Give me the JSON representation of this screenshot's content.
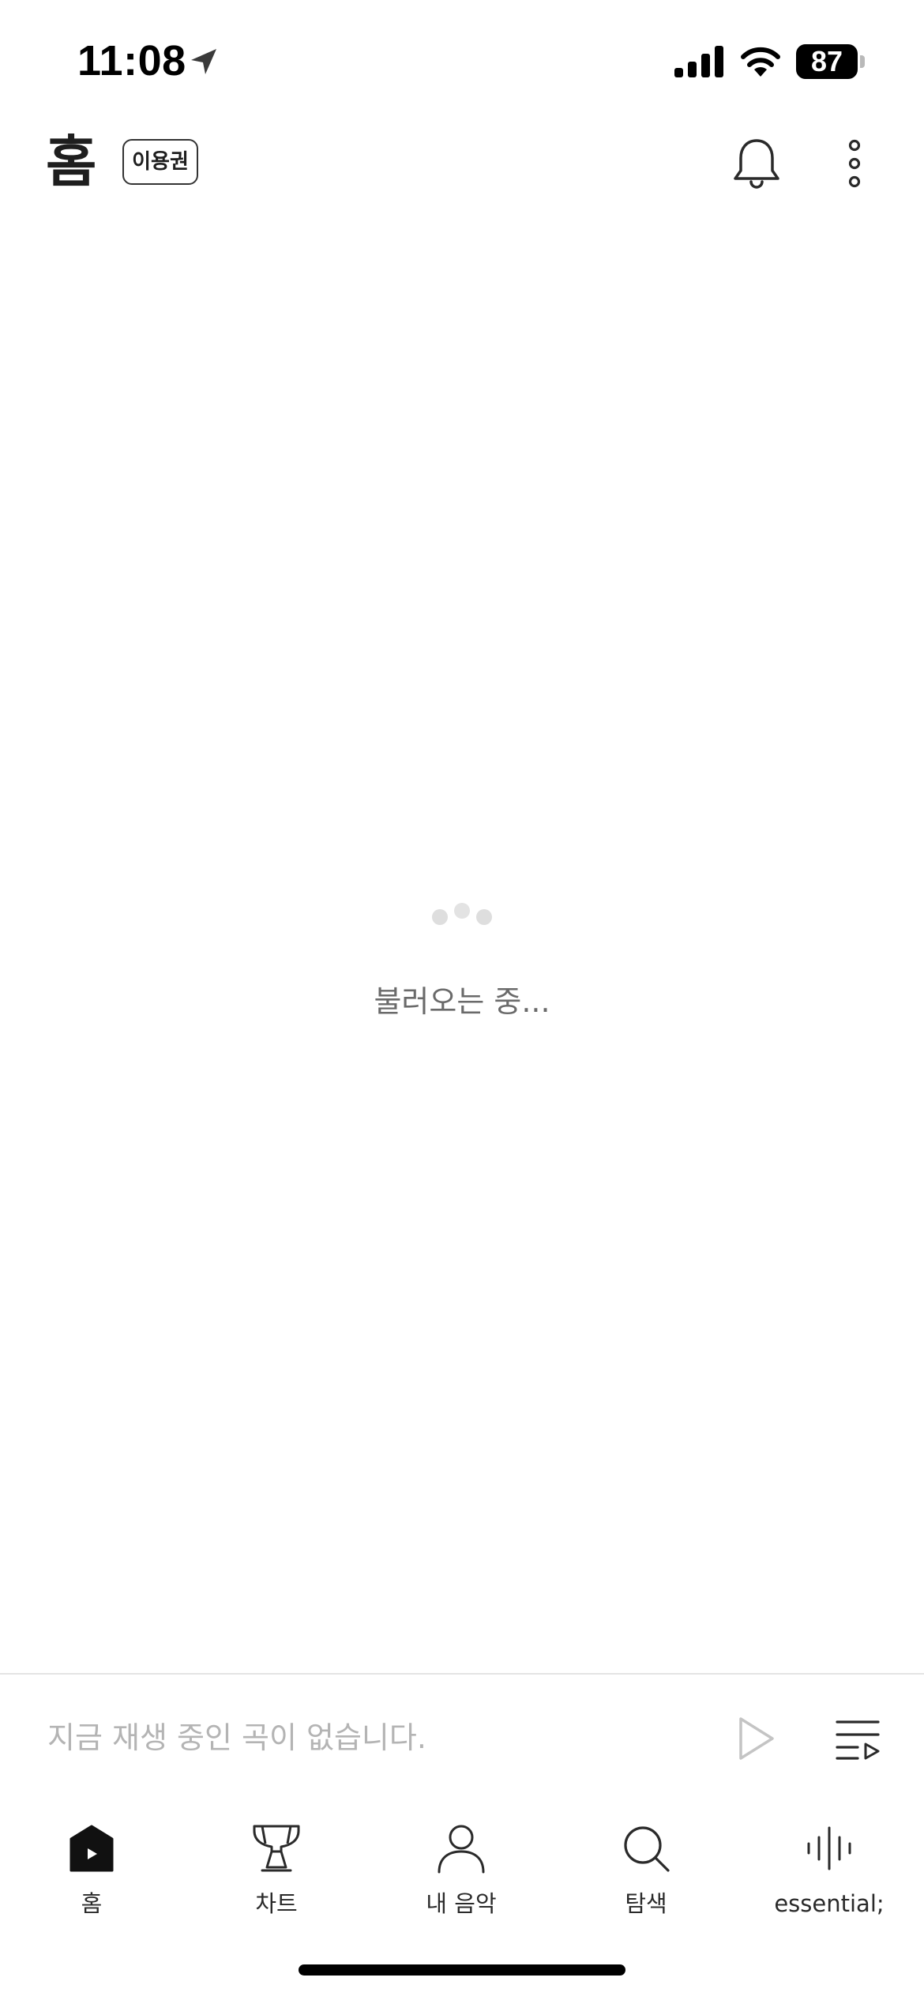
{
  "status_bar": {
    "time": "11:08",
    "battery": "87",
    "icons": [
      "location-arrow-icon",
      "cellular-signal-icon",
      "wifi-icon",
      "battery-icon"
    ]
  },
  "header": {
    "title": "홈",
    "pass_label": "이용권",
    "icons": [
      "bell-icon",
      "more-vertical-icon"
    ]
  },
  "main": {
    "loading_text": "불러오는 중..."
  },
  "mini_player": {
    "status_text": "지금 재생 중인 곡이 없습니다.",
    "icons": [
      "play-icon",
      "playlist-icon"
    ]
  },
  "tab_bar": {
    "items": [
      {
        "label": "홈",
        "icon": "home-icon",
        "active": true
      },
      {
        "label": "차트",
        "icon": "trophy-icon",
        "active": false
      },
      {
        "label": "내 음악",
        "icon": "person-icon",
        "active": false
      },
      {
        "label": "탐색",
        "icon": "search-icon",
        "active": false
      },
      {
        "label": "essential;",
        "icon": "soundwave-icon",
        "active": false
      }
    ]
  },
  "colors": {
    "text_primary": "#1e1e1e",
    "text_muted": "#b4b4b4",
    "loading_text": "#6a6a6a",
    "divider": "#e4e4e4"
  }
}
